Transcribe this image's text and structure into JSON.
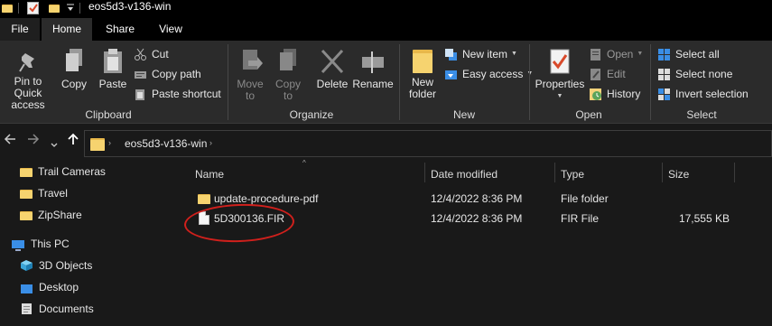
{
  "window": {
    "title": "eos5d3-v136-win",
    "colors": {
      "background": "#191919",
      "ribbon": "#2b2b2b",
      "folder": "#f6d36f",
      "annotation": "#d0201c",
      "accent_blue": "#3a8ee6"
    }
  },
  "tabs": [
    {
      "label": "File"
    },
    {
      "label": "Home"
    },
    {
      "label": "Share"
    },
    {
      "label": "View"
    }
  ],
  "ribbon": {
    "clipboard": {
      "label": "Clipboard",
      "pin_line1": "Pin to Quick",
      "pin_line2": "access",
      "copy": "Copy",
      "paste": "Paste",
      "cut": "Cut",
      "copy_path": "Copy path",
      "paste_shortcut": "Paste shortcut"
    },
    "organize": {
      "label": "Organize",
      "move_line1": "Move",
      "move_line2": "to",
      "copy_line1": "Copy",
      "copy_line2": "to",
      "delete": "Delete",
      "rename": "Rename"
    },
    "new": {
      "label": "New",
      "folder_line1": "New",
      "folder_line2": "folder",
      "new_item": "New item",
      "easy_access": "Easy access"
    },
    "open": {
      "label": "Open",
      "properties": "Properties",
      "open": "Open",
      "edit": "Edit",
      "history": "History"
    },
    "select": {
      "label": "Select",
      "select_all": "Select all",
      "select_none": "Select none",
      "invert": "Invert selection"
    }
  },
  "address": {
    "crumb": "eos5d3-v136-win"
  },
  "navpane": {
    "items": [
      {
        "label": "Trail Cameras",
        "icon": "folder-icon"
      },
      {
        "label": "Travel",
        "icon": "folder-icon"
      },
      {
        "label": "ZipShare",
        "icon": "folder-icon"
      },
      {
        "label": "This PC",
        "icon": "computer-icon"
      },
      {
        "label": "3D Objects",
        "icon": "cube-icon"
      },
      {
        "label": "Desktop",
        "icon": "desktop-icon"
      },
      {
        "label": "Documents",
        "icon": "documents-icon"
      }
    ]
  },
  "filelist": {
    "columns": [
      "Name",
      "Date modified",
      "Type",
      "Size"
    ],
    "rows": [
      {
        "name": "update-procedure-pdf",
        "date": "12/4/2022 8:36 PM",
        "type": "File folder",
        "size": "",
        "icon": "folder-icon"
      },
      {
        "name": "5D300136.FIR",
        "date": "12/4/2022 8:36 PM",
        "type": "FIR File",
        "size": "17,555 KB",
        "icon": "file-icon"
      }
    ]
  }
}
